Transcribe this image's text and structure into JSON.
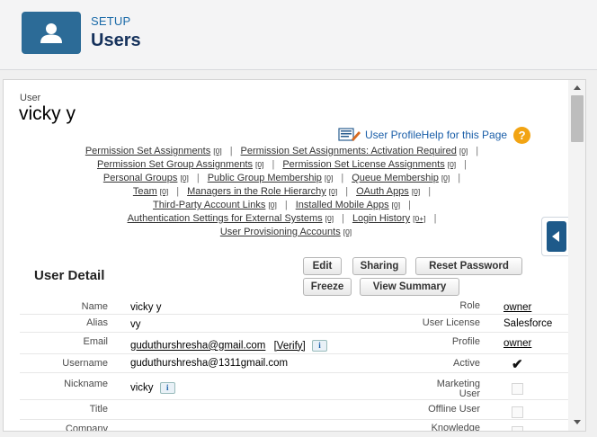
{
  "header": {
    "setup": "SETUP",
    "title": "Users",
    "icon": "user-icon"
  },
  "user": {
    "label": "User",
    "name": "vicky y"
  },
  "help": {
    "link_text": "User ProfileHelp for this Page",
    "help_icon": "?"
  },
  "related_links": [
    [
      {
        "label": "Permission Set Assignments",
        "count": "[0]"
      },
      {
        "label": "Permission Set Assignments: Activation Required",
        "count": "[0]"
      }
    ],
    [
      {
        "label": "Permission Set Group Assignments",
        "count": "[0]"
      },
      {
        "label": "Permission Set License Assignments",
        "count": "[0]"
      }
    ],
    [
      {
        "label": "Personal Groups",
        "count": "[0]"
      },
      {
        "label": "Public Group Membership",
        "count": "[0]"
      },
      {
        "label": "Queue Membership",
        "count": "[0]"
      }
    ],
    [
      {
        "label": "Team",
        "count": "[0]"
      },
      {
        "label": "Managers in the Role Hierarchy",
        "count": "[0]"
      },
      {
        "label": "OAuth Apps",
        "count": "[0]"
      }
    ],
    [
      {
        "label": "Third-Party Account Links",
        "count": "[0]"
      },
      {
        "label": "Installed Mobile Apps",
        "count": "[0]"
      }
    ],
    [
      {
        "label": "Authentication Settings for External Systems",
        "count": "[0]"
      },
      {
        "label": "Login History",
        "count": "[0+]"
      }
    ],
    [
      {
        "label": "User Provisioning Accounts",
        "count": "[0]"
      }
    ]
  ],
  "detail": {
    "title": "User Detail",
    "buttons": {
      "edit": "Edit",
      "sharing": "Sharing",
      "reset_password": "Reset Password",
      "freeze": "Freeze",
      "view_summary": "View Summary"
    },
    "fields": {
      "name_label": "Name",
      "name_value": "vicky y",
      "role_label": "Role",
      "role_value": "owner",
      "alias_label": "Alias",
      "alias_value": "vy",
      "license_label": "User License",
      "license_value": "Salesforce",
      "email_label": "Email",
      "email_value": "guduthurshresha@gmail.com",
      "verify_label": "[Verify]",
      "profile_label": "Profile",
      "profile_value": "owner",
      "username_label": "Username",
      "username_value": "guduthurshresha@1311gmail.com",
      "active_label": "Active",
      "active_value": true,
      "nickname_label": "Nickname",
      "nickname_value": "vicky",
      "marketing_label_1": "Marketing",
      "marketing_label_2": "User",
      "marketing_value": false,
      "title_label": "Title",
      "offline_label": "Offline User",
      "offline_value": false,
      "company_label": "Company",
      "knowledge_label": "Knowledge"
    },
    "info_icon": "i",
    "checkmark": "✔"
  },
  "colors": {
    "header_icon_bg": "#2c6b97",
    "setup_text": "#1a6aa8",
    "title_text": "#16325c",
    "help_icon_bg": "#f2a413",
    "side_tab": "#1e5a8a"
  }
}
